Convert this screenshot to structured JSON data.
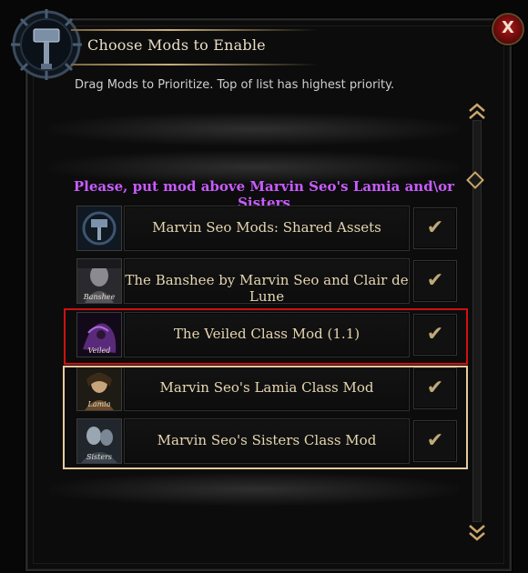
{
  "dialog": {
    "title": "Choose Mods to Enable",
    "subtitle": "Drag Mods to Prioritize. Top of list has highest priority.",
    "close_label": "X",
    "emblem_icon": "hammer-emblem-icon",
    "scroll_up_icon": "double-chevron-up-icon",
    "scroll_down_icon": "double-chevron-down-icon"
  },
  "warning": "Please, put mod above Marvin Seo's Lamia and\\or Sisters",
  "mods": [
    {
      "name": "Marvin Seo Mods: Shared Assets",
      "thumb_label": "",
      "thumb_icon": "hammer-icon",
      "checked": true,
      "check_glyph": "✔"
    },
    {
      "name": "The Banshee by Marvin Seo and Clair de Lune",
      "thumb_label": "Banshee",
      "thumb_icon": "banshee-portrait",
      "checked": true,
      "check_glyph": "✔"
    },
    {
      "name": "The Veiled Class Mod (1.1)",
      "thumb_label": "Veiled",
      "thumb_icon": "veiled-portrait",
      "checked": true,
      "check_glyph": "✔"
    },
    {
      "name": "Marvin Seo's Lamia Class Mod",
      "thumb_label": "Lamia",
      "thumb_icon": "lamia-portrait",
      "checked": true,
      "check_glyph": "✔"
    },
    {
      "name": "Marvin Seo's Sisters Class Mod",
      "thumb_label": "Sisters",
      "thumb_icon": "sisters-portrait",
      "checked": true,
      "check_glyph": "✔"
    }
  ],
  "colors": {
    "accent_gold": "#c9a66a",
    "warning_purple": "#c85cff",
    "highlight_red": "#d01010",
    "highlight_tan": "#e8caa0"
  }
}
